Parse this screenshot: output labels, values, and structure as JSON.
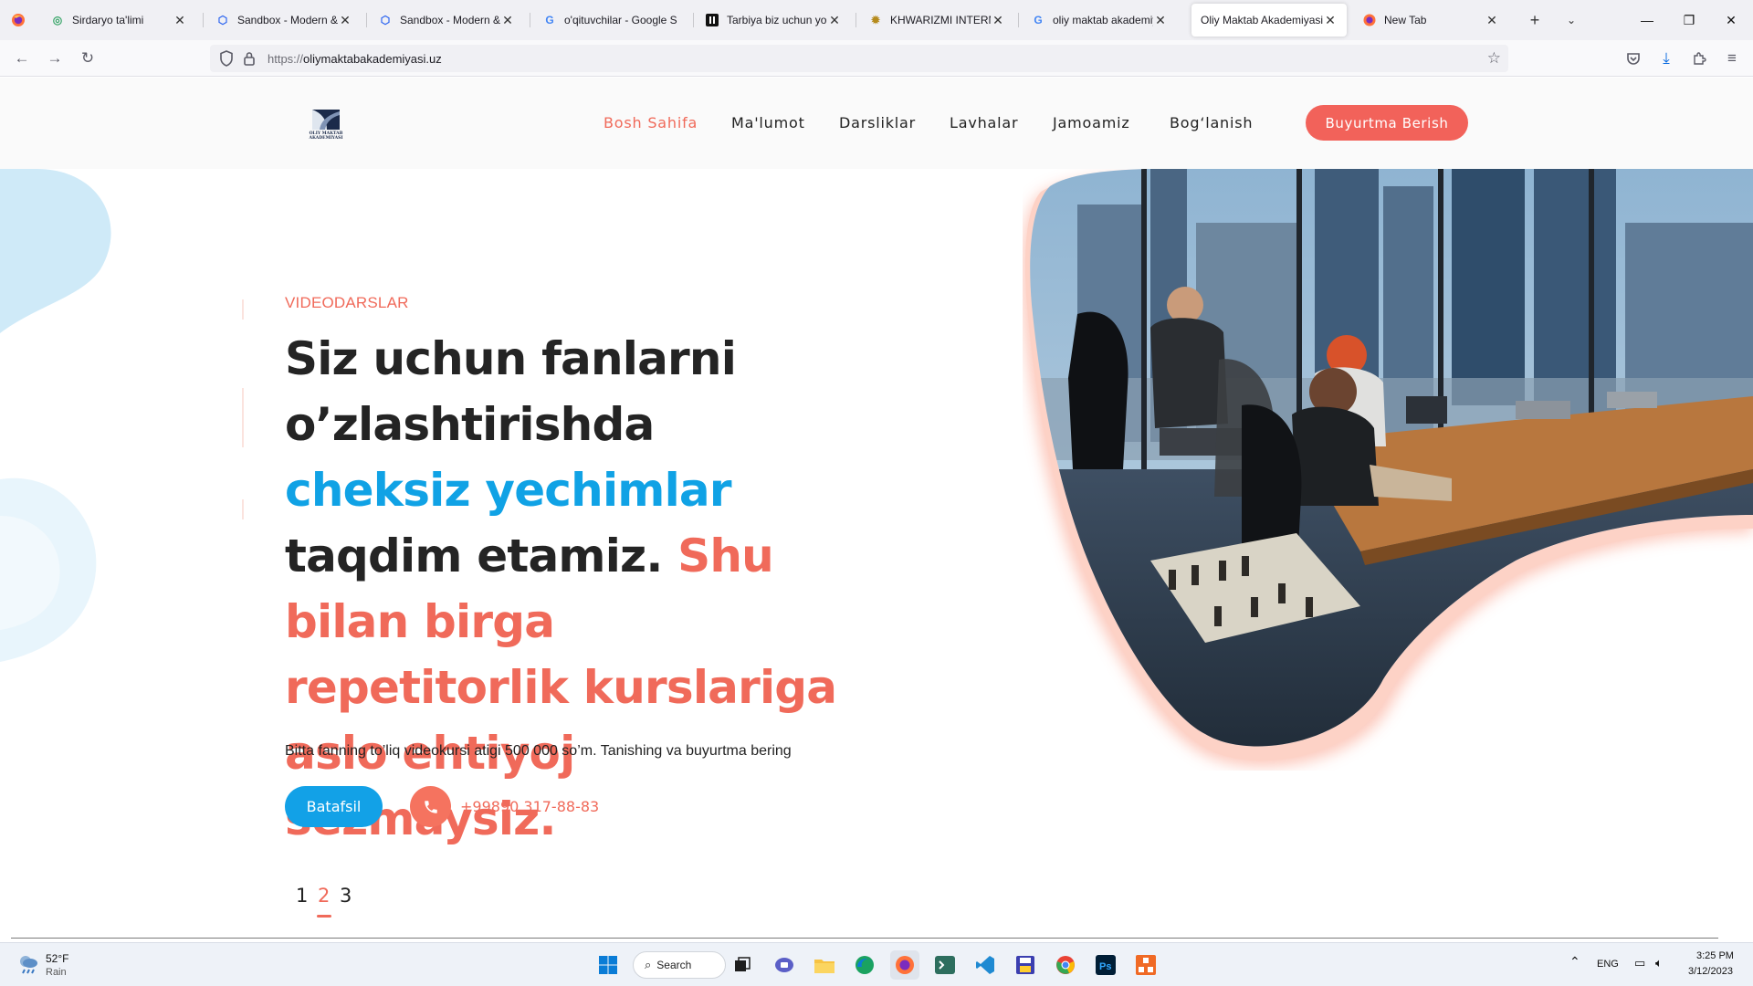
{
  "browser": {
    "tabs": [
      {
        "title": "Sirdaryo ta'limi",
        "icon": "sirdaryo-favicon",
        "active": false
      },
      {
        "title": "Sandbox - Modern & M",
        "icon": "sandbox-favicon",
        "active": false
      },
      {
        "title": "Sandbox - Modern & M",
        "icon": "sandbox-favicon",
        "active": false
      },
      {
        "title": "o'qituvchilar - Google S",
        "icon": "google-favicon",
        "active": false
      },
      {
        "title": "Tarbiya biz uchun yo ha",
        "icon": "tarbiya-favicon",
        "active": false
      },
      {
        "title": "KHWARIZMI INTERNAT",
        "icon": "khwarizmi-favicon",
        "active": false
      },
      {
        "title": "oliy maktab akademiya",
        "icon": "google-favicon",
        "active": false
      },
      {
        "title": "Oliy Maktab Akademiyasi",
        "icon": "none",
        "active": true
      },
      {
        "title": "New Tab",
        "icon": "firefox-favicon",
        "active": false
      }
    ],
    "url_protocol": "https://",
    "url_host": "oliymaktabakademiyasi.uz"
  },
  "site": {
    "logo_text_line1": "OLIY MAKTAB",
    "logo_text_line2": "AKADEMIYASI",
    "nav": [
      {
        "label": "Bosh Sahifa",
        "active": true
      },
      {
        "label": "Ma'lumot",
        "active": false
      },
      {
        "label": "Darsliklar",
        "active": false
      },
      {
        "label": "Lavhalar",
        "active": false
      },
      {
        "label": "Jamoamiz",
        "active": false
      },
      {
        "label": "Bog‘lanish",
        "active": false
      }
    ],
    "cta_label": "Buyurtma Berish"
  },
  "hero": {
    "eyebrow": "VIDEODARSLAR",
    "headline_part1": "Siz uchun fanlarni o’zlashtirishda ",
    "headline_blue": "cheksiz yechimlar",
    "headline_part2": " taqdim etamiz. ",
    "headline_coral": "Shu bilan birga repetitorlik kurslariga aslo ehtiyoj sezmaysiz.",
    "subtext": "Bitta fanning to’liq videokursi atigi 500 000 so’m. Tanishing va buyurtma bering",
    "more_button": "Batafsil",
    "phone": "+99890 317-88-83",
    "pages": [
      "1",
      "2",
      "3"
    ],
    "current_page": "2"
  },
  "taskbar": {
    "weather_temp": "52°F",
    "weather_desc": "Rain",
    "search_label": "Search",
    "lang": "ENG",
    "time": "3:25 PM",
    "date": "3/12/2023"
  },
  "colors": {
    "accent_coral": "#f06a5a",
    "accent_blue": "#10a2e5",
    "cta": "#f2625a"
  }
}
